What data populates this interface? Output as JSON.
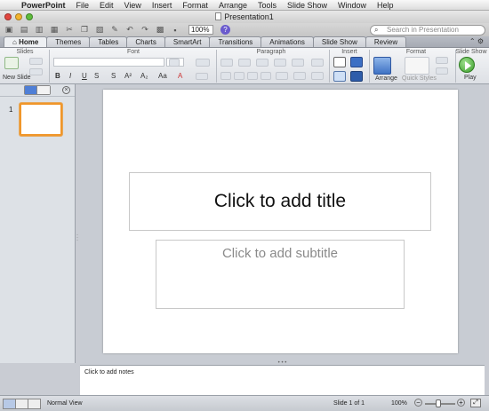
{
  "menubar": {
    "apple": "",
    "items": [
      "PowerPoint",
      "File",
      "Edit",
      "View",
      "Insert",
      "Format",
      "Arrange",
      "Tools",
      "Slide Show",
      "Window",
      "Help"
    ]
  },
  "window": {
    "title": "Presentation1",
    "lights": [
      "#e2463f",
      "#f3b42d",
      "#5ebd3b"
    ]
  },
  "toolbar": {
    "zoom": "100%",
    "help_glyph": "?",
    "search_placeholder": "Search in Presentation"
  },
  "ribbon": {
    "tabs": [
      "Home",
      "Themes",
      "Tables",
      "Charts",
      "SmartArt",
      "Transitions",
      "Animations",
      "Slide Show",
      "Review"
    ],
    "active_tab": "Home",
    "groups": [
      "Slides",
      "Font",
      "Paragraph",
      "Insert",
      "Format",
      "Slide Show"
    ],
    "new_slide_label": "New Slide",
    "arrange_label": "Arrange",
    "quick_styles_label": "Quick Styles",
    "play_label": "Play"
  },
  "sidepanel": {
    "slide_number": "1",
    "accent": "#f0962a"
  },
  "slide": {
    "title_placeholder": "Click to add title",
    "subtitle_placeholder": "Click to add subtitle"
  },
  "notes": {
    "placeholder": "Click to add notes"
  },
  "statusbar": {
    "view_name": "Normal View",
    "slide_position": "Slide 1 of 1",
    "zoom": "100%",
    "zoom_minus": "−",
    "zoom_plus": "+"
  }
}
